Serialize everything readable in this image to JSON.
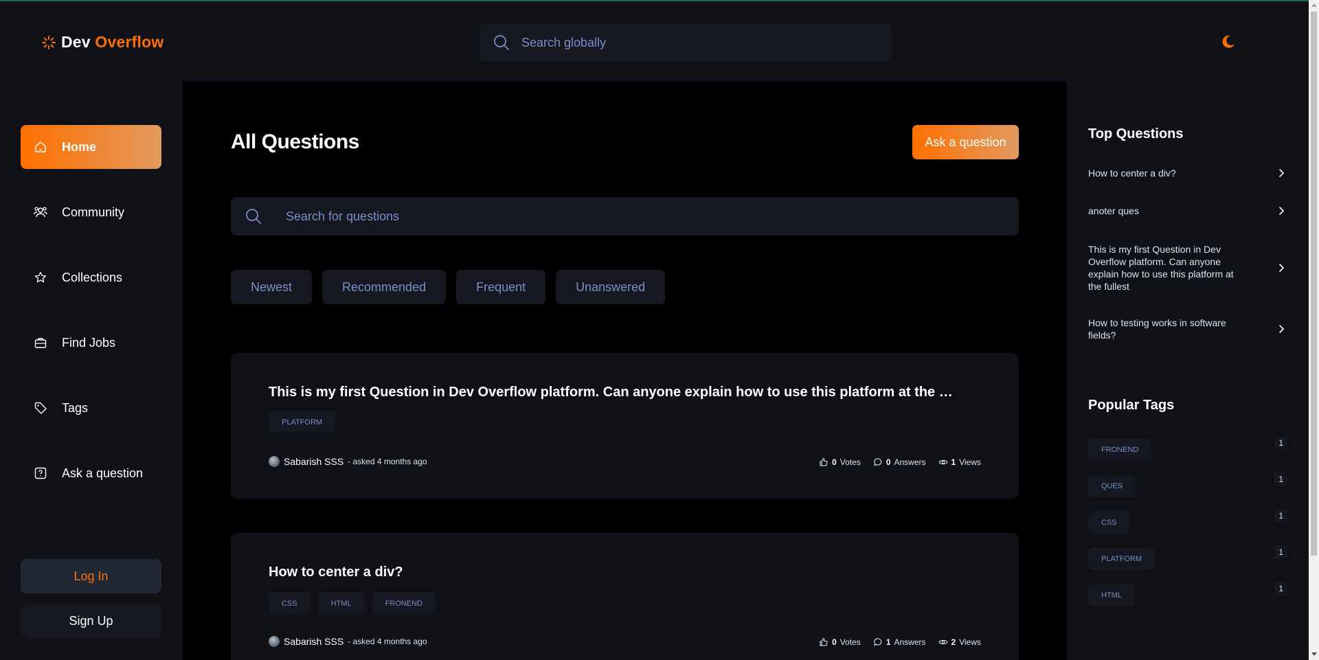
{
  "brand": {
    "name_part1": "Dev",
    "name_part2": "Overflow",
    "accent": "#ff7000"
  },
  "header": {
    "search_placeholder": "Search globally",
    "theme_icon": "moon-icon"
  },
  "sidebar": {
    "items": [
      {
        "label": "Home",
        "icon": "home-icon",
        "active": true
      },
      {
        "label": "Community",
        "icon": "users-icon"
      },
      {
        "label": "Collections",
        "icon": "star-icon"
      },
      {
        "label": "Find Jobs",
        "icon": "briefcase-icon"
      },
      {
        "label": "Tags",
        "icon": "tag-icon"
      },
      {
        "label": "Ask a question",
        "icon": "question-icon"
      }
    ],
    "login_label": "Log In",
    "signup_label": "Sign Up"
  },
  "main": {
    "title": "All Questions",
    "ask_button": "Ask a question",
    "search_placeholder": "Search for questions",
    "filters": [
      "Newest",
      "Recommended",
      "Frequent",
      "Unanswered"
    ],
    "questions": [
      {
        "title": "This is my first Question in Dev Overflow platform. Can anyone explain how to use this platform at the fullest?",
        "tags": [
          "PLATFORM"
        ],
        "author": "Sabarish SSS",
        "asked": "- asked 4 months ago",
        "votes": "0",
        "votes_label": "Votes",
        "answers": "0",
        "answers_label": "Answers",
        "views": "1",
        "views_label": "Views"
      },
      {
        "title": "How to center a div?",
        "tags": [
          "CSS",
          "HTML",
          "FRONEND"
        ],
        "author": "Sabarish SSS",
        "asked": "- asked 4 months ago",
        "votes": "0",
        "votes_label": "Votes",
        "answers": "1",
        "answers_label": "Answers",
        "views": "2",
        "views_label": "Views"
      }
    ]
  },
  "rightbar": {
    "top_questions_title": "Top Questions",
    "top_questions": [
      "How to center a div?",
      "anoter ques",
      "This is my first Question in Dev Overflow platform. Can anyone explain how to use this platform at the fullest",
      "How to testing works in software fields?"
    ],
    "popular_tags_title": "Popular Tags",
    "popular_tags": [
      {
        "name": "FRONEND",
        "count": "1"
      },
      {
        "name": "QUES",
        "count": "1"
      },
      {
        "name": "CSS",
        "count": "1"
      },
      {
        "name": "PLATFORM",
        "count": "1"
      },
      {
        "name": "HTML",
        "count": "1"
      }
    ]
  }
}
